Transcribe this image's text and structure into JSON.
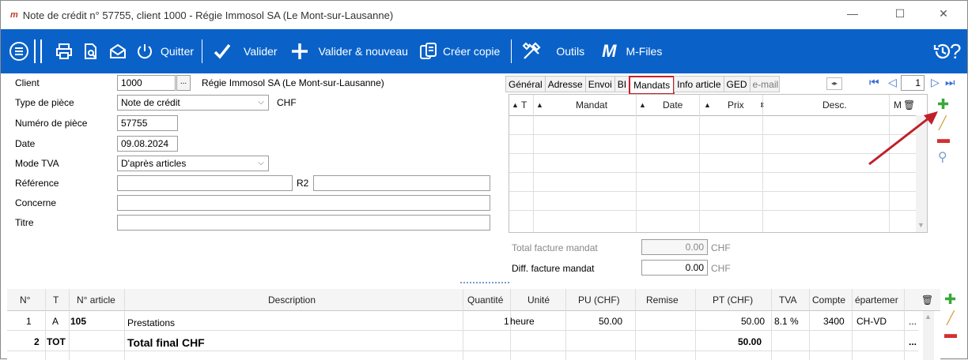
{
  "window": {
    "app_logo": "m",
    "title": "Note de crédit n° 57755, client 1000 - Régie Immosol SA (Le Mont-sur-Lausanne)",
    "minimize": "—",
    "maximize": "☐",
    "close": "✕"
  },
  "toolbar": {
    "quit_label": "Quitter",
    "validate_label": "Valider",
    "validate_new_label": "Valider & nouveau",
    "copy_label": "Créer copie",
    "tools_label": "Outils",
    "mfiles_label": "M-Files",
    "colors": {
      "background": "#0a62c8",
      "text": "#ffffff"
    }
  },
  "form": {
    "client_label": "Client",
    "client_value": "1000",
    "client_name": "Régie Immosol SA (Le Mont-sur-Lausanne)",
    "ellipsis": "...",
    "type_label": "Type de pièce",
    "type_value": "Note de crédit",
    "currency": "CHF",
    "number_label": "Numéro de pièce",
    "number_value": "57755",
    "date_label": "Date",
    "date_value": "09.08.2024",
    "tva_label": "Mode TVA",
    "tva_value": "D'après articles",
    "reference_label": "Référence",
    "reference_value": "",
    "r2_label": "R2",
    "r2_value": "",
    "concerne_label": "Concerne",
    "concerne_value": "",
    "titre_label": "Titre",
    "titre_value": ""
  },
  "tabs": [
    {
      "label": "Général"
    },
    {
      "label": "Adresse"
    },
    {
      "label": "Envoi"
    },
    {
      "label": "BI"
    },
    {
      "label": "Mandats",
      "active": true
    },
    {
      "label": "Info article"
    },
    {
      "label": "GED"
    },
    {
      "label": "e-mail"
    }
  ],
  "pager": {
    "current": "1"
  },
  "mandats_grid": {
    "columns": [
      "T",
      "Mandat",
      "Date",
      "Prix",
      "Desc.",
      "M"
    ],
    "rows": []
  },
  "totals": {
    "total_label": "Total facture mandat",
    "total_value": "0.00",
    "total_currency": "CHF",
    "diff_label": "Diff. facture mandat",
    "diff_value": "0.00",
    "diff_currency": "CHF"
  },
  "lines_grid": {
    "columns": [
      "N°",
      "T",
      "N° article",
      "Description",
      "Quantité",
      "Unité",
      "PU (CHF)",
      "Remise",
      "PT (CHF)",
      "TVA",
      "Compte",
      "épartemer"
    ],
    "rows": [
      {
        "n": "1",
        "t": "A",
        "article": "105",
        "description": "Prestations",
        "qty": "1",
        "unit": "heure",
        "pu": "50.00",
        "remise": "",
        "pt": "50.00",
        "tva": "8.1 %",
        "compte": "3400",
        "dept": "CH-VD",
        "more": "..."
      },
      {
        "n": "2",
        "t": "TOT",
        "article": "",
        "description": "Total final CHF",
        "qty": "",
        "unit": "",
        "pu": "",
        "remise": "",
        "pt": "50.00",
        "tva": "",
        "compte": "",
        "dept": "",
        "more": "..."
      }
    ]
  },
  "icons": {
    "menu": "menu-icon",
    "print": "print-icon",
    "preview": "preview-icon",
    "mail": "mail-icon",
    "power": "power-icon",
    "check": "check-icon",
    "plus": "plus-icon",
    "copy": "copy-icon",
    "tools": "tools-icon",
    "mfiles": "m-files-icon",
    "history": "history-icon",
    "help": "help-icon"
  }
}
